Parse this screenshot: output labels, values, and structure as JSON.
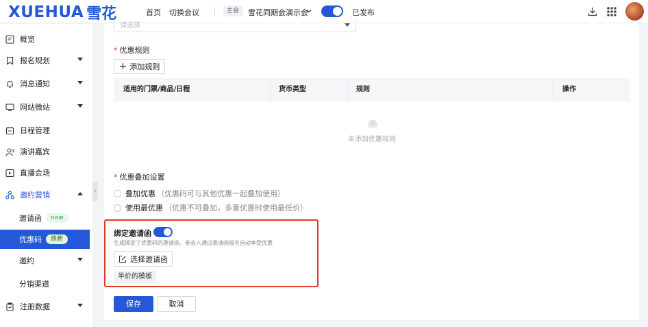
{
  "header": {
    "logo_en": "XUEHUA",
    "logo_cn": "雪花",
    "nav_home": "首页",
    "nav_switch": "切换会议",
    "host_tag": "主会",
    "event_name": "雪花同期会演示会",
    "published": "已发布",
    "accent": "#2458d8"
  },
  "sidebar": {
    "items": [
      {
        "label": "概览",
        "icon": "overview-icon"
      },
      {
        "label": "报名规划",
        "icon": "bookmark-icon"
      },
      {
        "label": "消息通知",
        "icon": "bell-icon"
      },
      {
        "label": "网站微站",
        "icon": "monitor-icon"
      },
      {
        "label": "日程管理",
        "icon": "calendar-icon"
      },
      {
        "label": "演讲嘉宾",
        "icon": "user-icon"
      },
      {
        "label": "直播会场",
        "icon": "play-icon"
      },
      {
        "label": "邀约营销",
        "icon": "share-icon"
      }
    ],
    "sub_items": [
      {
        "label": "邀请函",
        "badge": "new"
      },
      {
        "label": "优惠码",
        "badge": "焕新"
      },
      {
        "label": "邀约",
        "badge": ""
      },
      {
        "label": "分销渠道",
        "badge": ""
      }
    ],
    "last_item": {
      "label": "注册数据",
      "icon": "clipboard-icon"
    }
  },
  "form": {
    "select_placeholder": "请选择",
    "rules_label": "优惠规则",
    "add_rule": "添加规则",
    "table_headers": [
      "适用的门票/商品/日程",
      "货币类型",
      "规则",
      "操作"
    ],
    "empty_text": "未添加优惠规则",
    "stack_label": "优惠叠加设置",
    "stack_options": [
      {
        "label": "叠加优惠",
        "hint": "（优惠码可与其他优惠一起叠加使用）"
      },
      {
        "label": "使用最优惠",
        "hint": "（优惠不可叠加，多重优惠时使用最低价）"
      }
    ],
    "bind_label": "绑定邀请函",
    "bind_desc": "生成绑定了优惠码的邀请函，参会人通过邀请函报名自动享受优惠",
    "choose_invite": "选择邀请函",
    "template_name": "半价的模板",
    "save": "保存",
    "cancel": "取消"
  }
}
